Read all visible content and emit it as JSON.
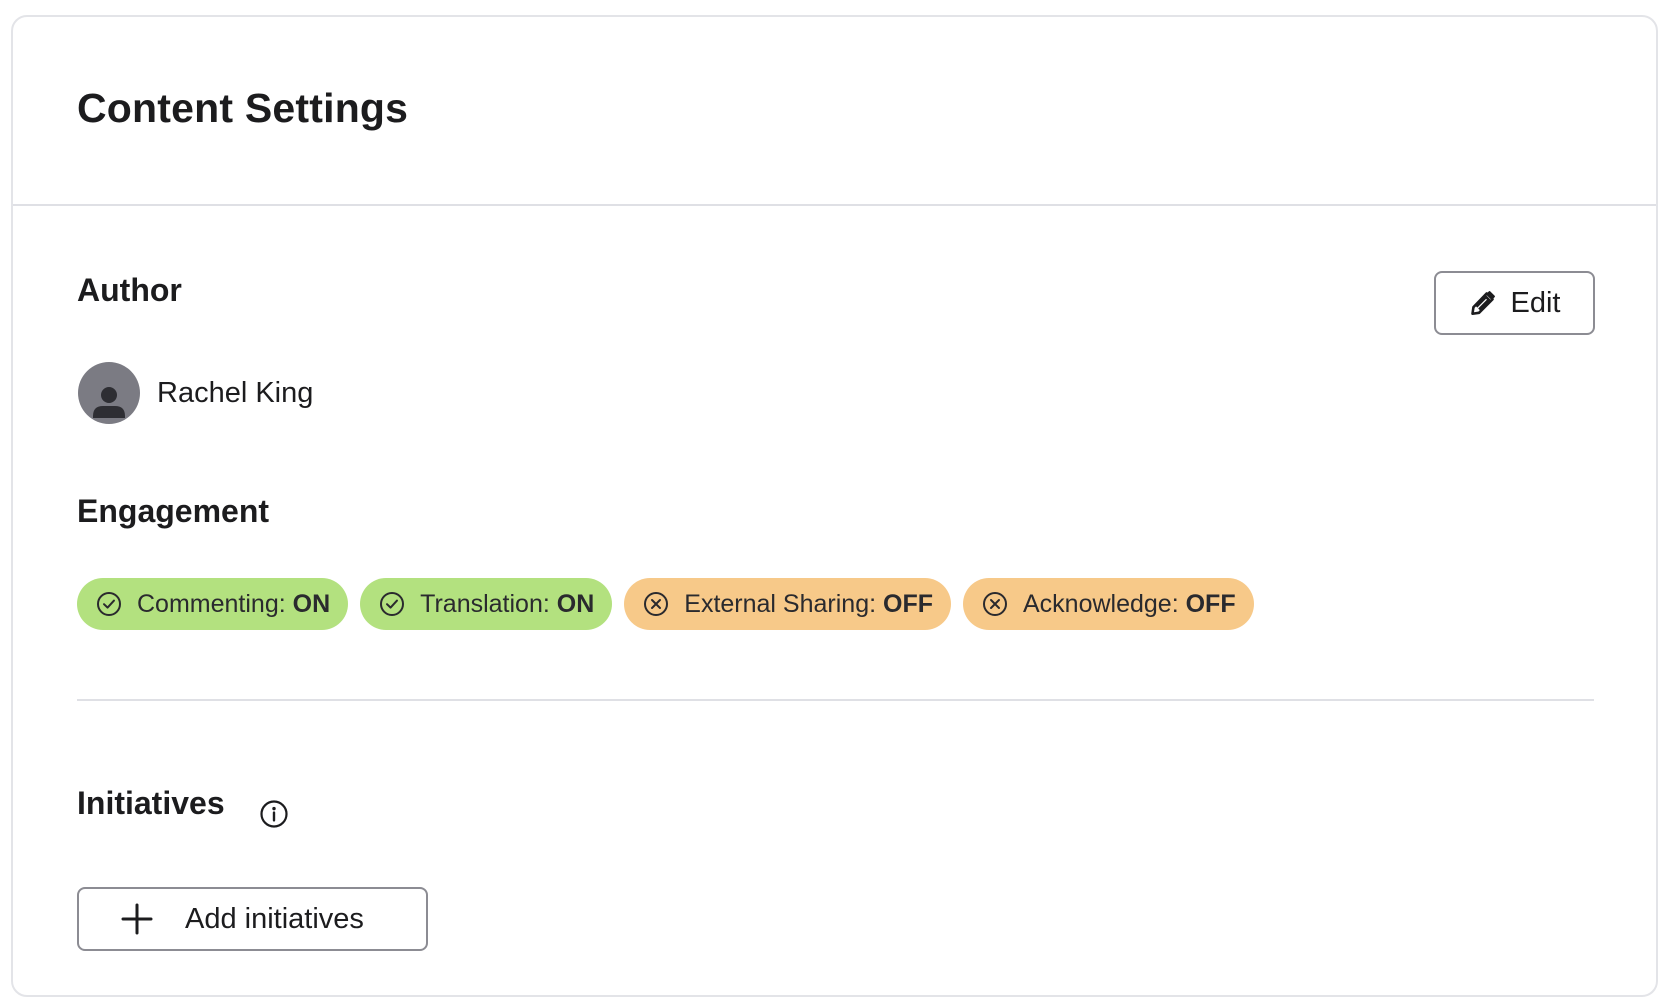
{
  "header": {
    "title": "Content Settings"
  },
  "author": {
    "section_title": "Author",
    "edit_label": "Edit",
    "name": "Rachel King",
    "avatar_icon": "person-icon",
    "avatar_color": "#7b7b83"
  },
  "engagement": {
    "section_title": "Engagement",
    "settings": [
      {
        "label": "Commenting:",
        "value": "ON",
        "state": "on",
        "icon": "check-circle-icon"
      },
      {
        "label": "Translation:",
        "value": "ON",
        "state": "on",
        "icon": "check-circle-icon"
      },
      {
        "label": "External Sharing:",
        "value": "OFF",
        "state": "off",
        "icon": "x-circle-icon"
      },
      {
        "label": "Acknowledge:",
        "value": "OFF",
        "state": "off",
        "icon": "x-circle-icon"
      }
    ],
    "colors": {
      "on": "#b3e17f",
      "off": "#f7c989"
    }
  },
  "initiatives": {
    "section_title": "Initiatives",
    "info_icon": "info-icon",
    "add_label": "Add initiatives"
  }
}
